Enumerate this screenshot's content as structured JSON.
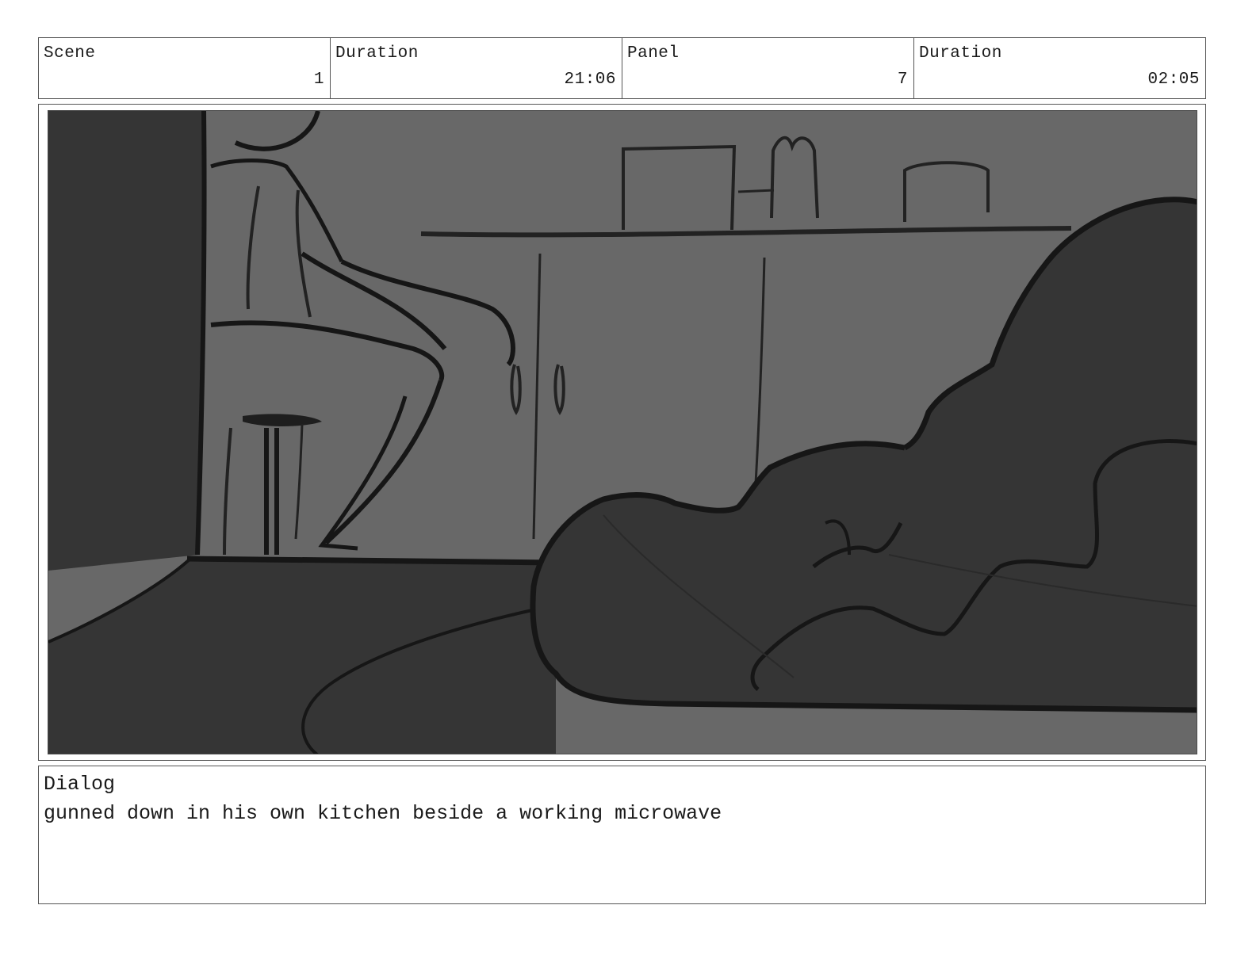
{
  "header": {
    "cells": [
      {
        "label": "Scene",
        "value": "1"
      },
      {
        "label": "Duration",
        "value": "21:06"
      },
      {
        "label": "Panel",
        "value": "7"
      },
      {
        "label": "Duration",
        "value": "02:05"
      }
    ]
  },
  "dialog": {
    "label": "Dialog",
    "text": "gunned down in his own kitchen beside a working microwave"
  },
  "colors": {
    "wall": "#686868",
    "shadow": "#353535",
    "ink": "#161616",
    "border": "#555555"
  }
}
